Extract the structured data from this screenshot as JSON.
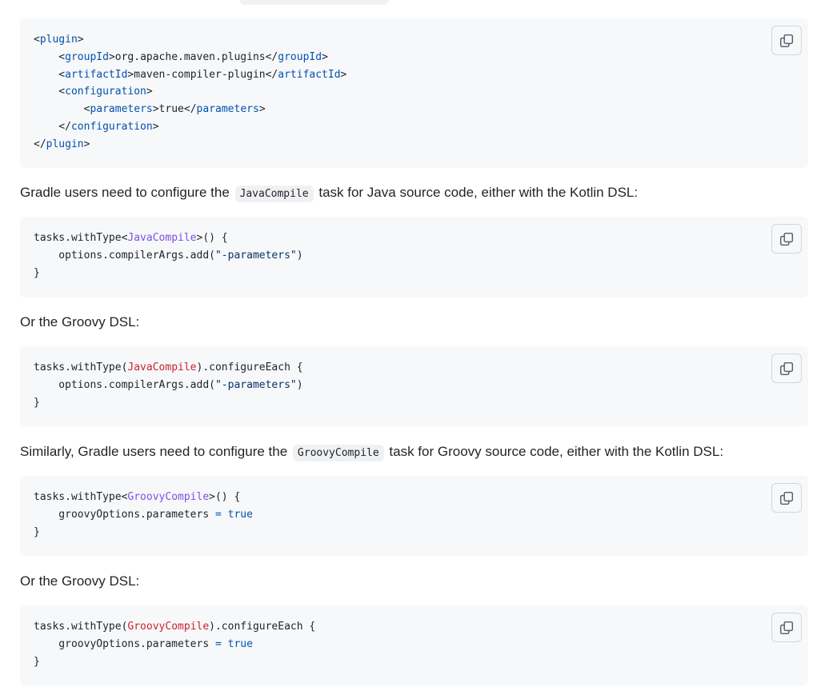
{
  "maven_block": {
    "lines": [
      [
        "<",
        "plugin",
        ">"
      ],
      [
        "    <",
        "groupId",
        ">org.apache.maven.plugins</",
        "groupId",
        ">"
      ],
      [
        "    <",
        "artifactId",
        ">maven-compiler-plugin</",
        "artifactId",
        ">"
      ],
      [
        "    <",
        "configuration",
        ">"
      ],
      [
        "        <",
        "parameters",
        ">true</",
        "parameters",
        ">"
      ],
      [
        "    </",
        "configuration",
        ">"
      ],
      [
        "</",
        "plugin",
        ">"
      ]
    ]
  },
  "para1": {
    "before": "Gradle users need to configure the",
    "code": "JavaCompile",
    "after": "task for Java source code, either with the Kotlin DSL:"
  },
  "kotlin_java": {
    "l1_a": "tasks.withType<",
    "l1_type": "JavaCompile",
    "l1_b": ">() {",
    "l2_a": "    options.compilerArgs.add(",
    "l2_str": "\"-parameters\"",
    "l2_b": ")",
    "l3": "}"
  },
  "para2": "Or the Groovy DSL:",
  "groovy_java": {
    "l1_a": "tasks.withType(",
    "l1_type": "JavaCompile",
    "l1_b": ").configureEach {",
    "l2_a": "    options.compilerArgs.add(",
    "l2_str": "\"-parameters\"",
    "l2_b": ")",
    "l3": "}"
  },
  "para3": {
    "before": "Similarly, Gradle users need to configure the",
    "code": "GroovyCompile",
    "after": "task for Groovy source code, either with the Kotlin DSL:"
  },
  "kotlin_groovy": {
    "l1_a": "tasks.withType<",
    "l1_type": "GroovyCompile",
    "l1_b": ">() {",
    "l2_a": "    groovyOptions.parameters ",
    "l2_eq": "=",
    "l2_val": "true",
    "l3": "}"
  },
  "para4": "Or the Groovy DSL:",
  "groovy_groovy": {
    "l1_a": "tasks.withType(",
    "l1_type": "GroovyCompile",
    "l1_b": ").configureEach {",
    "l2_a": "    groovyOptions.parameters ",
    "l2_eq": "=",
    "l2_val": "true",
    "l3": "}"
  },
  "icons": {
    "copy": "copy-icon"
  },
  "colors": {
    "code_bg": "#f6f8fa",
    "tag": "#0550ae",
    "type_kotlin": "#8250df",
    "type_groovy": "#cf222e",
    "string": "#0a3069"
  }
}
